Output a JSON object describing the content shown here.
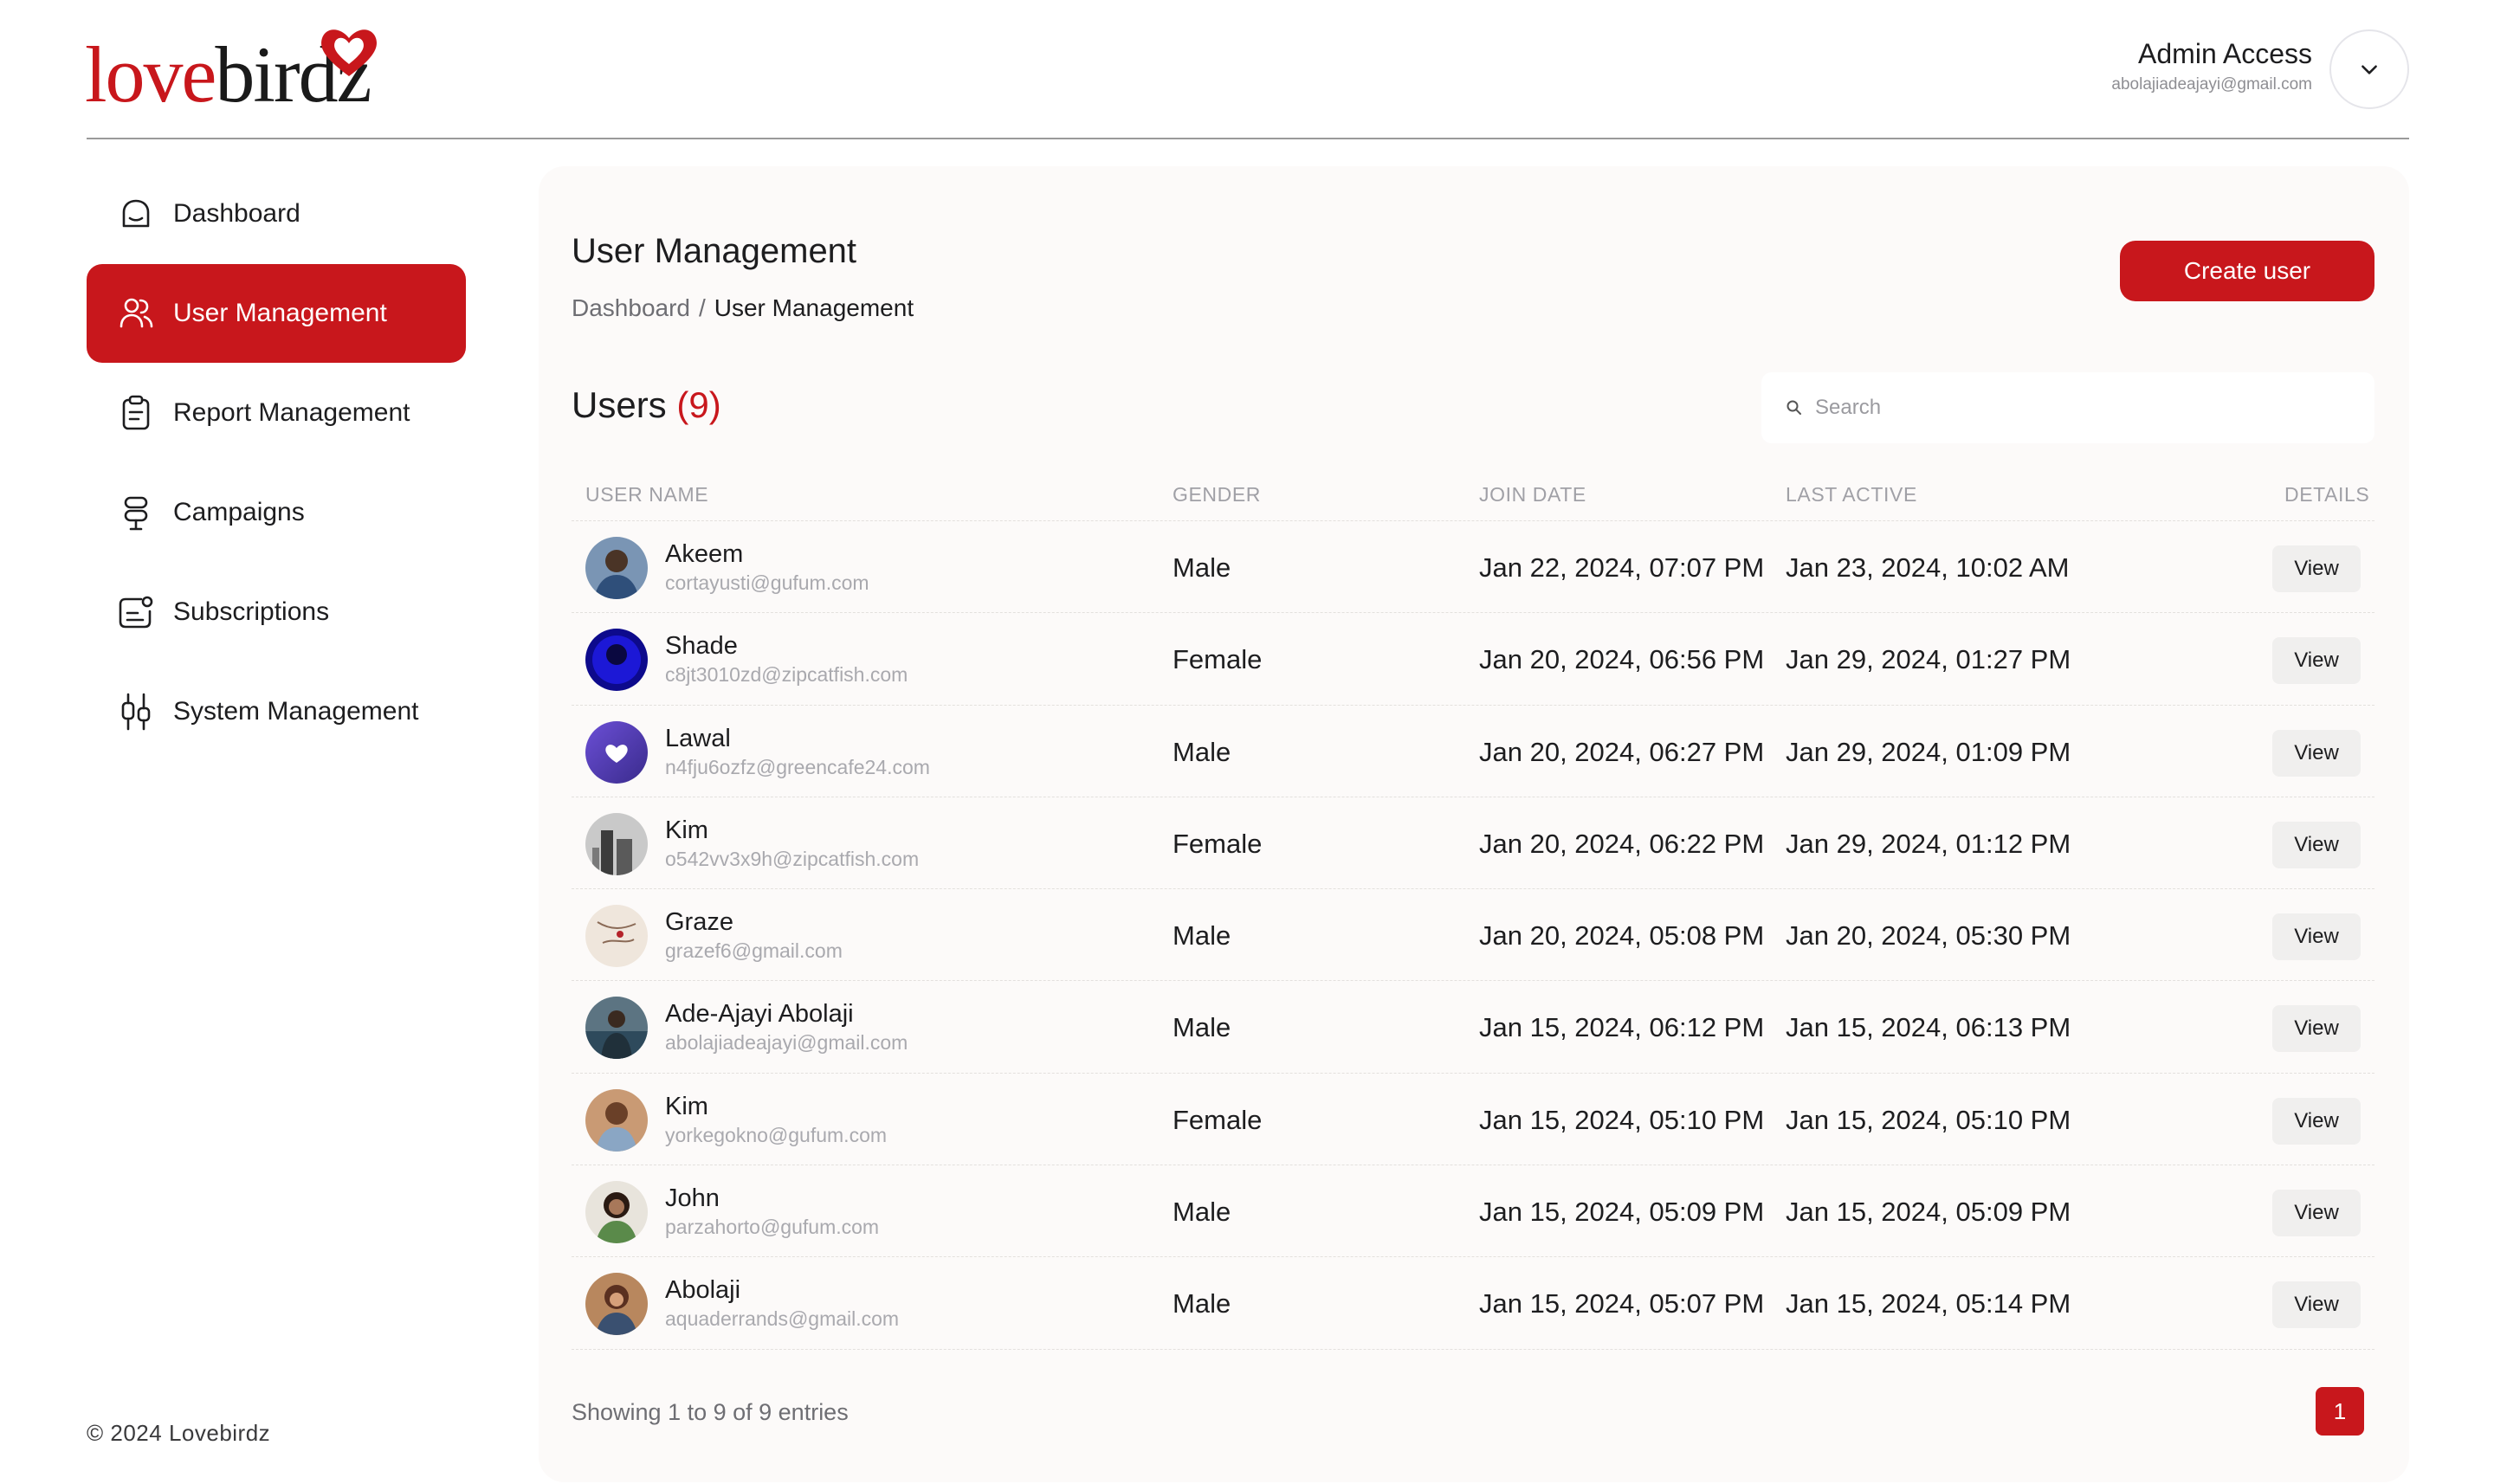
{
  "brand": {
    "logo_part1": "love",
    "logo_part2": "birdz",
    "accent": "#c8171c"
  },
  "admin": {
    "name": "Admin Access",
    "email": "abolajiadeajayi@gmail.com"
  },
  "sidebar": {
    "items": [
      {
        "label": "Dashboard",
        "icon": "home-icon",
        "active": false
      },
      {
        "label": "User Management",
        "icon": "users-icon",
        "active": true
      },
      {
        "label": "Report Management",
        "icon": "clipboard-icon",
        "active": false
      },
      {
        "label": "Campaigns",
        "icon": "signpost-icon",
        "active": false
      },
      {
        "label": "Subscriptions",
        "icon": "subscription-icon",
        "active": false
      },
      {
        "label": "System Management",
        "icon": "sliders-icon",
        "active": false
      }
    ]
  },
  "footer": {
    "copyright": "© 2024 Lovebirdz"
  },
  "main": {
    "title": "User Management",
    "breadcrumb": {
      "root": "Dashboard",
      "sep": "/",
      "current": "User Management"
    },
    "create_label": "Create user",
    "users_label": "Users",
    "users_count": "(9)",
    "search_placeholder": "Search",
    "columns": {
      "name": "USER NAME",
      "gender": "GENDER",
      "join": "JOIN DATE",
      "active": "LAST ACTIVE",
      "details": "DETAILS"
    },
    "rows": [
      {
        "name": "Akeem",
        "email": "cortayusti@gufum.com",
        "gender": "Male",
        "join": "Jan 22, 2024, 07:07 PM",
        "active": "Jan 23, 2024, 10:02 AM",
        "view": "View"
      },
      {
        "name": "Shade",
        "email": "c8jt3010zd@zipcatfish.com",
        "gender": "Female",
        "join": "Jan 20, 2024, 06:56 PM",
        "active": "Jan 29, 2024, 01:27 PM",
        "view": "View"
      },
      {
        "name": "Lawal",
        "email": "n4fju6ozfz@greencafe24.com",
        "gender": "Male",
        "join": "Jan 20, 2024, 06:27 PM",
        "active": "Jan 29, 2024, 01:09 PM",
        "view": "View"
      },
      {
        "name": "Kim",
        "email": "o542vv3x9h@zipcatfish.com",
        "gender": "Female",
        "join": "Jan 20, 2024, 06:22 PM",
        "active": "Jan 29, 2024, 01:12 PM",
        "view": "View"
      },
      {
        "name": "Graze",
        "email": "grazef6@gmail.com",
        "gender": "Male",
        "join": "Jan 20, 2024, 05:08 PM",
        "active": "Jan 20, 2024, 05:30 PM",
        "view": "View"
      },
      {
        "name": "Ade-Ajayi Abolaji",
        "email": "abolajiadeajayi@gmail.com",
        "gender": "Male",
        "join": "Jan 15, 2024, 06:12 PM",
        "active": "Jan 15, 2024, 06:13 PM",
        "view": "View"
      },
      {
        "name": "Kim",
        "email": "yorkegokno@gufum.com",
        "gender": "Female",
        "join": "Jan 15, 2024, 05:10 PM",
        "active": "Jan 15, 2024, 05:10 PM",
        "view": "View"
      },
      {
        "name": "John",
        "email": "parzahorto@gufum.com",
        "gender": "Male",
        "join": "Jan 15, 2024, 05:09 PM",
        "active": "Jan 15, 2024, 05:09 PM",
        "view": "View"
      },
      {
        "name": "Abolaji",
        "email": "aquaderrands@gmail.com",
        "gender": "Male",
        "join": "Jan 15, 2024, 05:07 PM",
        "active": "Jan 15, 2024, 05:14 PM",
        "view": "View"
      }
    ],
    "showing": "Showing 1 to 9 of 9 entries",
    "page": "1"
  }
}
